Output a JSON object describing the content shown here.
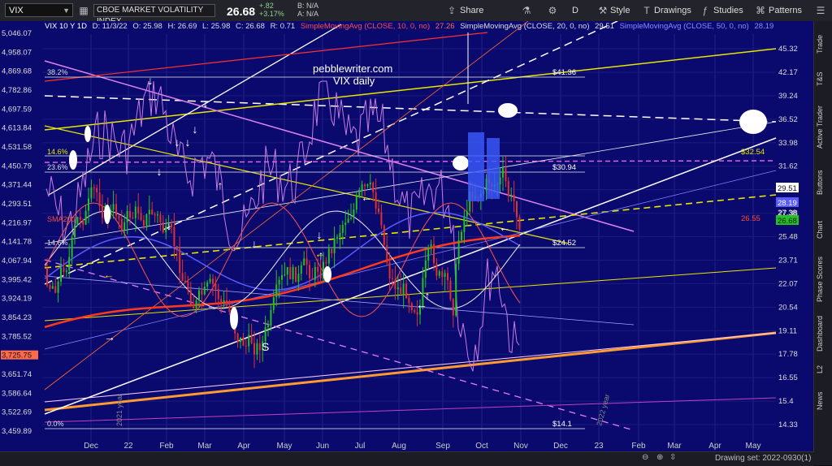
{
  "toolbar": {
    "symbol": "VIX",
    "quote_name": "CBOE MARKET VOLATILITY INDEX",
    "last": "26.68",
    "change": "+.82",
    "change_pct": "+3.17%",
    "bid": "B: N/A",
    "ask": "A: N/A",
    "share": "Share",
    "period": "D",
    "style": "Style",
    "drawings": "Drawings",
    "studies": "Studies",
    "patterns": "Patterns"
  },
  "sidebar": [
    "Trade",
    "T&S",
    "Active Trader",
    "Buttons",
    "Chart",
    "Phase Scores",
    "Dashboard",
    "L2",
    "News"
  ],
  "chart_header": {
    "title": "VIX 10 Y 1D",
    "date": "D: 11/3/22",
    "open": "O: 25.98",
    "high": "H: 26.69",
    "low": "L: 25.98",
    "close": "C: 26.68",
    "range": "R: 0.71",
    "sma10_label": "SimpleMovingAvg (CLOSE, 10, 0, no)",
    "sma10_value": "27.26",
    "sma20_label": "SimpleMovingAvg (CLOSE, 20, 0, no)",
    "sma20_value": "29.51",
    "sma50_label": "SimpleMovingAvg (CLOSE, 50, 0, no)",
    "sma50_value": "28.19"
  },
  "annotations": {
    "site": "pebblewriter.com",
    "subtitle": "VIX daily",
    "sma200": "SMA200",
    "s_label": "S",
    "year_2021": "2021 year",
    "year_2022": "2022 year"
  },
  "fib_levels": [
    {
      "label": "38.2%",
      "value": "$41.36"
    },
    {
      "label": "14.6%",
      "value": "$32.54"
    },
    {
      "label": "23.6%",
      "value": "$30.94"
    },
    {
      "label": "14.6%",
      "value": "$24.52"
    },
    {
      "label": "0.0%",
      "value": "$14.1"
    }
  ],
  "price_badges": {
    "sma20": "29.51",
    "sma50": "28.19",
    "price1": "27.38",
    "price2": "26.55",
    "last": "26.68"
  },
  "bottom": {
    "drawing_set": "Drawing set: 2022-0930(1)"
  },
  "chart_data": {
    "type": "line",
    "x_ticks": [
      "Dec",
      "22",
      "Feb",
      "Mar",
      "Apr",
      "May",
      "Jun",
      "Jul",
      "Aug",
      "Sep",
      "Oct",
      "Nov",
      "Dec",
      "23",
      "Feb",
      "Mar",
      "Apr",
      "May"
    ],
    "right_axis": [
      "45.32",
      "42.17",
      "39.24",
      "36.52",
      "33.98",
      "31.62",
      "29.42",
      "27.38",
      "25.48",
      "23.71",
      "22.07",
      "20.54",
      "19.11",
      "17.78",
      "16.55",
      "15.4",
      "14.33"
    ],
    "left_axis": [
      "5,046.07",
      "4,958.07",
      "4,869.68",
      "4,782.86",
      "4,697.59",
      "4,613.84",
      "4,531.58",
      "4,450.79",
      "4,371.44",
      "4,293.51",
      "4,216.97",
      "4,141.78",
      "4,067.94",
      "3,995.42",
      "3,924.19",
      "3,854.23",
      "3,785.52",
      "3,725.75",
      "3,651.74",
      "3,586.64",
      "3,522.69",
      "3,459.89"
    ],
    "colors": {
      "up": "#22c222",
      "down": "#e03030",
      "bg": "#0a0a6e",
      "purple": "#c77ae0",
      "sma200": "#ff3a1a",
      "yellow": "#e6e600"
    }
  }
}
